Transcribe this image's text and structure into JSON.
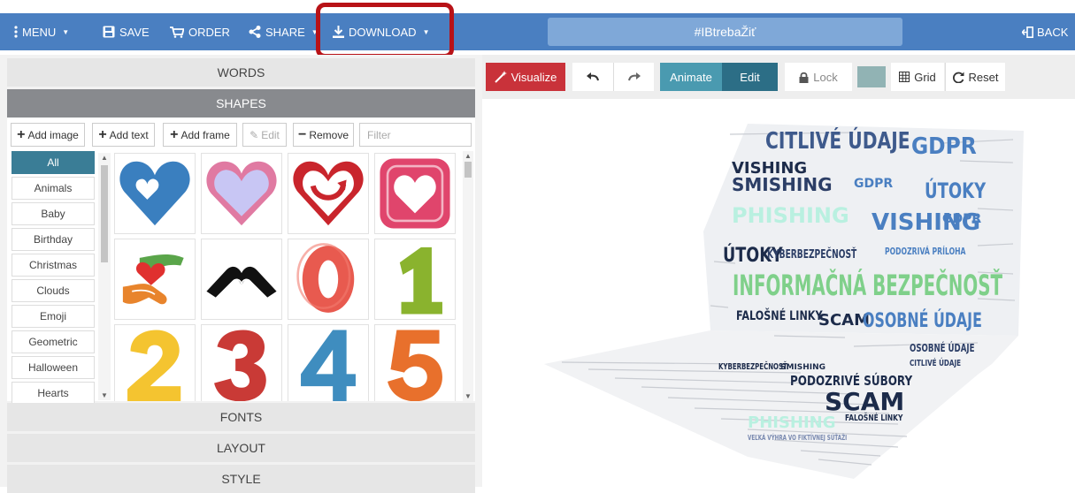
{
  "topbar": {
    "menu_label": "MENU",
    "save_label": "SAVE",
    "order_label": "ORDER",
    "share_label": "SHARE",
    "download_label": "DOWNLOAD",
    "title_value": "#IBtrebaŽiť",
    "back_label": "BACK"
  },
  "left_panel": {
    "sections": {
      "words": "WORDS",
      "shapes": "SHAPES",
      "fonts": "FONTS",
      "layout": "LAYOUT",
      "style": "STYLE"
    },
    "tools": {
      "add_image": "Add image",
      "add_text": "Add text",
      "add_frame": "Add frame",
      "edit": "Edit",
      "remove": "Remove",
      "filter_placeholder": "Filter"
    },
    "categories": [
      "All",
      "Animals",
      "Baby",
      "Birthday",
      "Christmas",
      "Clouds",
      "Emoji",
      "Geometric",
      "Halloween",
      "Hearts"
    ],
    "selected_category": "All",
    "shapes": [
      "blue heart",
      "pink outline heart",
      "red arrow heart",
      "pink square heart",
      "hands heart",
      "hands heart silhouette",
      "0",
      "1",
      "2",
      "3",
      "4",
      "5"
    ]
  },
  "canvas_toolbar": {
    "visualize": "Visualize",
    "animate": "Animate",
    "edit": "Edit",
    "lock": "Lock",
    "grid": "Grid",
    "reset": "Reset",
    "swatch_color": "#91b3b4"
  },
  "word_cloud": {
    "words": [
      "CITLIVÉ ÚDAJE",
      "GDPR",
      "VISHING",
      "SMISHING",
      "ÚTOKY",
      "PHISHING",
      "INFORMAČNÁ BEZPEČNOSŤ",
      "KYBERBEZPEČNOSŤ",
      "PODOZRIVÁ PRÍLOHA",
      "SCAM",
      "FALOŠNÉ LINKY",
      "OSOBNÉ ÚDAJE",
      "PODOZRIVÉ SÚBORY",
      "FALOŠNÉ LINKY",
      "VEĽKÁ VÝHRA VO FIKTÍVNEJ SÚŤAŽI"
    ]
  }
}
